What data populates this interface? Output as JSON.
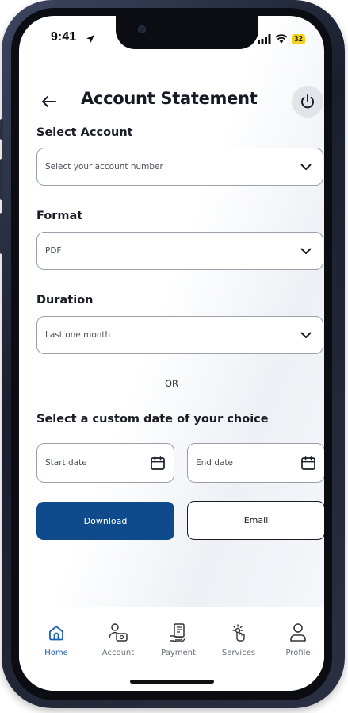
{
  "status_bar": {
    "time": "9:41",
    "battery": "32"
  },
  "header": {
    "title": "Account Statement",
    "back_icon": "back-arrow-icon",
    "power_icon": "power-icon"
  },
  "form": {
    "account": {
      "label": "Select Account",
      "value": "Select your account number"
    },
    "format": {
      "label": "Format",
      "value": "PDF"
    },
    "duration": {
      "label": "Duration",
      "value": "Last one month"
    },
    "or_text": "OR",
    "custom_label": "Select a custom date of your choice",
    "start_date": "Start date",
    "end_date": "End date"
  },
  "actions": {
    "download": "Download",
    "email": "Email"
  },
  "bottom_nav": {
    "items": [
      {
        "label": "Home",
        "icon": "home-icon",
        "active": true
      },
      {
        "label": "Account",
        "icon": "account-icon",
        "active": false
      },
      {
        "label": "Payment",
        "icon": "payment-icon",
        "active": false
      },
      {
        "label": "Services",
        "icon": "services-icon",
        "active": false
      },
      {
        "label": "Profile",
        "icon": "profile-icon",
        "active": false
      }
    ]
  },
  "colors": {
    "primary": "#0e4a8c",
    "nav_active": "#1d5fb4",
    "battery": "#f2d21b"
  }
}
